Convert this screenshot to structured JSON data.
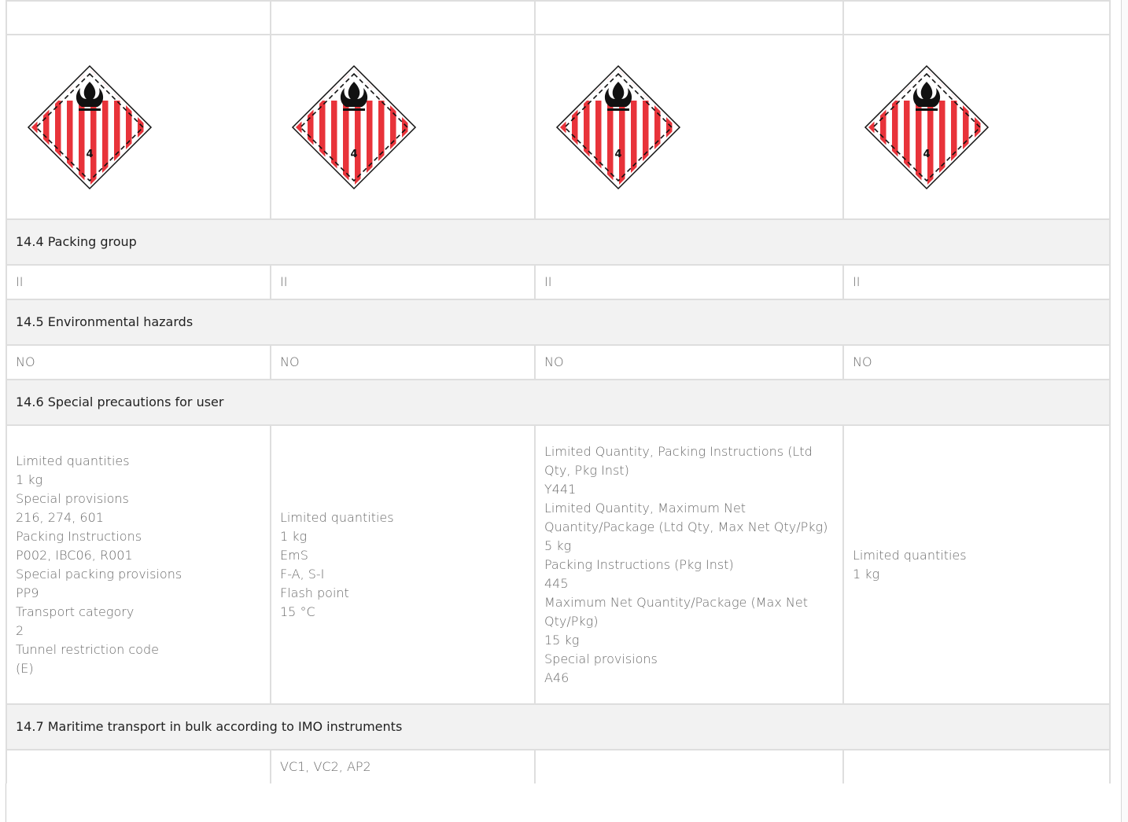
{
  "hazard_icon": "class-4-flammable-solid-placard",
  "placard_number": "4",
  "sections": {
    "packing_group": {
      "heading": "14.4 Packing group",
      "values": [
        "II",
        "II",
        "II",
        "II"
      ]
    },
    "environmental": {
      "heading": "14.5 Environmental hazards",
      "values": [
        "NO",
        "NO",
        "NO",
        "NO"
      ]
    },
    "precautions": {
      "heading": "14.6 Special precautions for user",
      "col1": [
        "Limited quantities",
        "1 kg",
        "Special provisions",
        "216, 274, 601",
        "Packing Instructions",
        "P002, IBC06, R001",
        "Special packing provisions",
        "PP9",
        "Transport category",
        "2",
        "Tunnel restriction code",
        "(E)"
      ],
      "col2": [
        "Limited quantities",
        "1 kg",
        "EmS",
        "F-A, S-I",
        "Flash point",
        "15 °C"
      ],
      "col3": [
        "Limited Quantity, Packing Instructions (Ltd Qty, Pkg Inst)",
        "Y441",
        "Limited Quantity, Maximum Net Quantity/Package (Ltd Qty, Max Net Qty/Pkg)",
        "5 kg",
        "Packing Instructions (Pkg Inst)",
        "445",
        "Maximum Net Quantity/Package (Max Net Qty/Pkg)",
        "15 kg",
        "Special provisions",
        "A46"
      ],
      "col4": [
        "Limited quantities",
        "1 kg"
      ]
    },
    "imo_bulk": {
      "heading": "14.7 Maritime transport in bulk according to IMO instruments",
      "values": [
        "",
        "VC1, VC2, AP2",
        "",
        ""
      ]
    }
  },
  "colors": {
    "stripe_red": "#e8333a",
    "section_bg": "#f2f2f2",
    "border": "#dedede"
  }
}
